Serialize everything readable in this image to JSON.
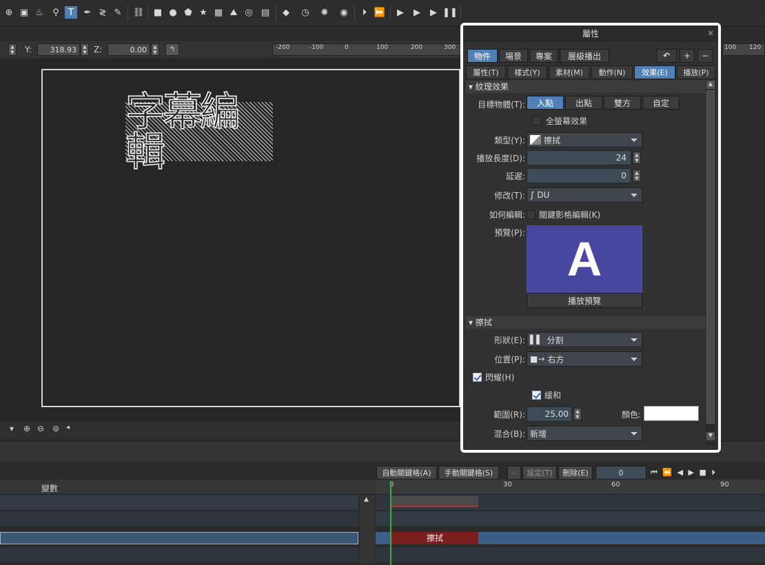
{
  "toolbar": {
    "icons": [
      "crosshair-icon",
      "image-icon",
      "brush-icon",
      "zoom-icon",
      "text-tool-icon",
      "pen-icon",
      "curve-icon",
      "eyedropper-icon",
      "link-icon",
      "square-icon",
      "circle-icon",
      "pentagon-icon",
      "star-icon",
      "calendar-icon",
      "mountain-icon",
      "counter-icon",
      "time-icon",
      "cube-icon",
      "clock-icon",
      "sun-icon",
      "sound-icon",
      "play-step-icon",
      "play-frame-icon",
      "preview-icon",
      "preview2-icon",
      "play-icon",
      "pause-icon",
      "stop-icon",
      "one-icon",
      "two-icon",
      "three-icon",
      "fill-icon",
      "align-icon"
    ]
  },
  "coords": {
    "y_label": "Y:",
    "y_value": "318.93",
    "z_label": "Z:",
    "z_value": "0.00"
  },
  "ruler": {
    "ticks": [
      "-200",
      "-100",
      "0",
      "100",
      "200",
      "300"
    ]
  },
  "ruler_right": {
    "ticks": [
      "100",
      "120"
    ]
  },
  "canvas": {
    "subtitle": "字幕編輯"
  },
  "panel": {
    "title": "屬性",
    "close": "×",
    "tabs_top": [
      "物件",
      "場景",
      "專案",
      "層級播出"
    ],
    "tabs_top_buttons": [
      "↶",
      "+",
      "−"
    ],
    "tabs_second": [
      "屬性(T)",
      "樣式(Y)",
      "素材(M)",
      "動作(N)",
      "效果(E)",
      "播放(P)"
    ],
    "section1": "▾ 紋理效果",
    "target_label": "目標物體(T):",
    "target_options": [
      "入點",
      "出點",
      "雙方",
      "自定"
    ],
    "fullscreen_label": "全螢幕效果",
    "type_label": "類型(Y):",
    "type_value": "擦拭",
    "duration_label": "播放長度(D):",
    "duration_value": "24",
    "delay_label": "延遲:",
    "delay_value": "0",
    "modify_label": "修改(T):",
    "modify_value": "DU",
    "edit_label": "如何編輯:",
    "keyframe_label": "關鍵影格編輯(K)",
    "preview_label": "預覽(P):",
    "preview_letter": "A",
    "preview_button": "播放預覽",
    "section2": "▾ 擦拭",
    "shape_label": "形狀(E):",
    "shape_value": "分割",
    "position_label": "位置(P):",
    "position_value": "右方",
    "flash_label": "閃耀(H)",
    "soft_label": "緩和",
    "range_label": "範圍(R):",
    "range_value": "25.00",
    "color_label": "顏色:",
    "blend_label": "混合(B):",
    "blend_value": "新增",
    "accent": "#4f80b6",
    "preview_bg": "#4a47a0"
  },
  "timeline": {
    "auto_key": "自動關鍵格(A)",
    "manual_key": "手動關鍵格(S)",
    "set": "設定(T)",
    "delete": "刪除(E)",
    "frame": "0",
    "variables": "變數",
    "ticks": [
      "0",
      "30",
      "60",
      "90"
    ],
    "clip_label": "擦拭"
  }
}
